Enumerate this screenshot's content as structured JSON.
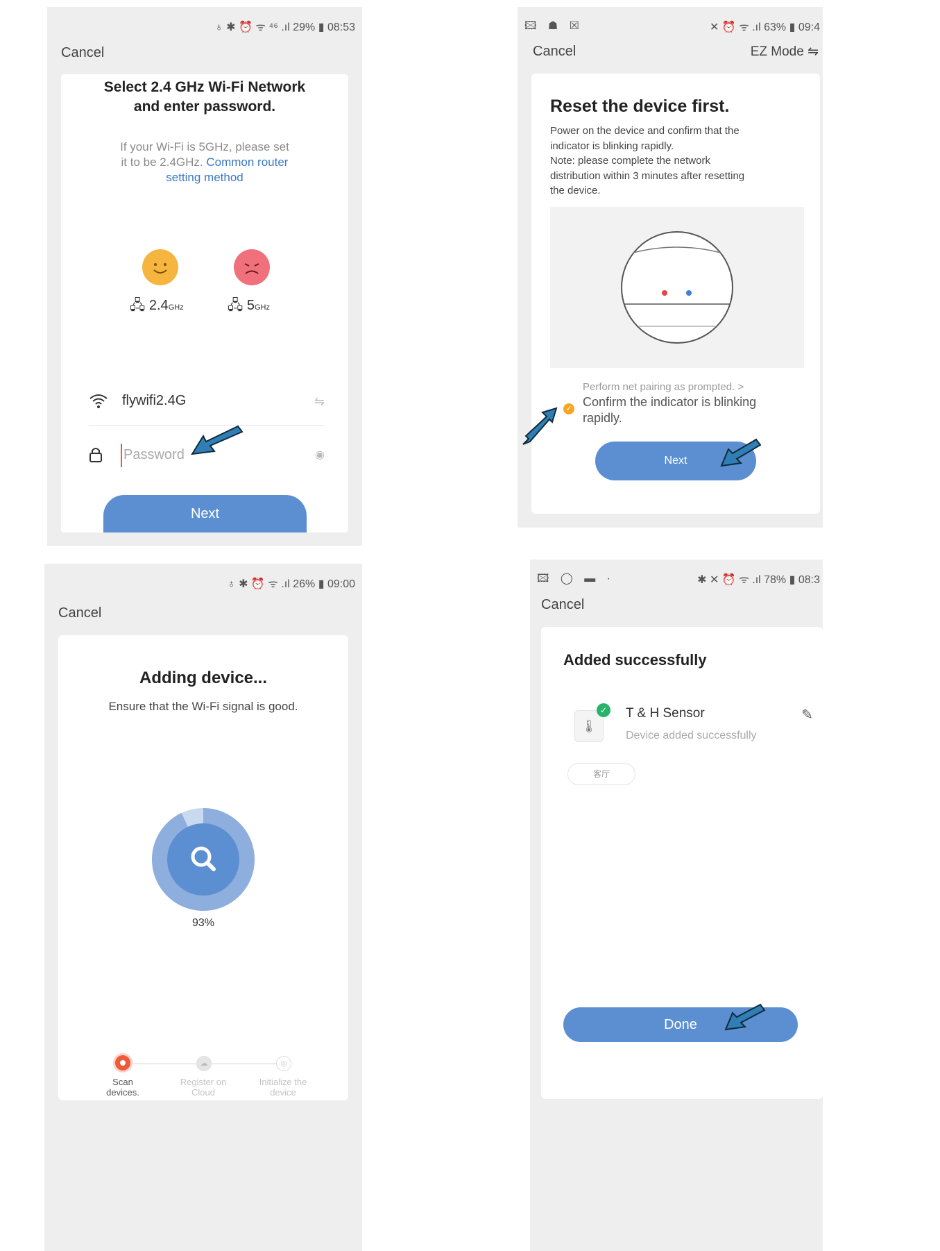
{
  "screen1": {
    "status": "♁ ✱ ⏰ ᯤ ⁴⁶ .ıl 29% ▮ 08:53",
    "cancel": "Cancel",
    "title_line1": "Select 2.4 GHz Wi-Fi Network",
    "title_line2": "and enter password.",
    "desc_line1": "If your Wi-Fi is 5GHz, please set",
    "desc_line2_plain": "it to be 2.4GHz.",
    "desc_link_part1": "Common router",
    "desc_link_part2": "setting method",
    "band_good_label": "2.4",
    "band_good_unit": "GHz",
    "band_bad_label": "5",
    "band_bad_unit": "GHz",
    "wifi_name": "flywifi2.4G",
    "password_placeholder": "Password",
    "next": "Next"
  },
  "screen2": {
    "status_left": "🖾 ☗ ☒",
    "status_right": "✕ ⏰ ᯤ .ıl 63% ▮ 09:4",
    "cancel": "Cancel",
    "mode": "EZ Mode ⇋",
    "title": "Reset the device first.",
    "desc_line1": "Power on the device and confirm that the",
    "desc_line2": "indicator is blinking rapidly.",
    "desc_line3": "Note: please complete the network",
    "desc_line4": "distribution within 3 minutes after resetting",
    "desc_line5": "the device.",
    "prompt_link": "Perform net pairing as prompted. >",
    "confirm_line1": "Confirm the indicator is blinking",
    "confirm_line2": "rapidly.",
    "next": "Next"
  },
  "screen3": {
    "status": "♁ ✱ ⏰ ᯤ .ıl 26% ▮ 09:00",
    "cancel": "Cancel",
    "title": "Adding device...",
    "subtitle": "Ensure that the Wi-Fi signal is good.",
    "progress_percent": 93,
    "progress_text": "93%",
    "steps": [
      {
        "line1": "Scan",
        "line2": "devices."
      },
      {
        "line1": "Register on",
        "line2": "Cloud"
      },
      {
        "line1": "Initialize the",
        "line2": "device"
      }
    ]
  },
  "screen4": {
    "status_left": "🖾 ◯ ▬ ·",
    "status_right": "✱ ✕ ⏰ ᯤ .ıl 78% ▮ 08:3",
    "cancel": "Cancel",
    "title": "Added successfully",
    "device_name": "T & H Sensor",
    "device_status": "Device added successfully",
    "room_tag": "客厅",
    "done": "Done"
  },
  "colors": {
    "accent_blue": "#5b8fd1",
    "link_blue": "#3a78c7",
    "happy_yellow": "#f5b53f",
    "sad_pink": "#f0707b",
    "step_active": "#f05a3a",
    "check_green": "#27b36a",
    "arrow_fill": "#2f7fb6"
  }
}
